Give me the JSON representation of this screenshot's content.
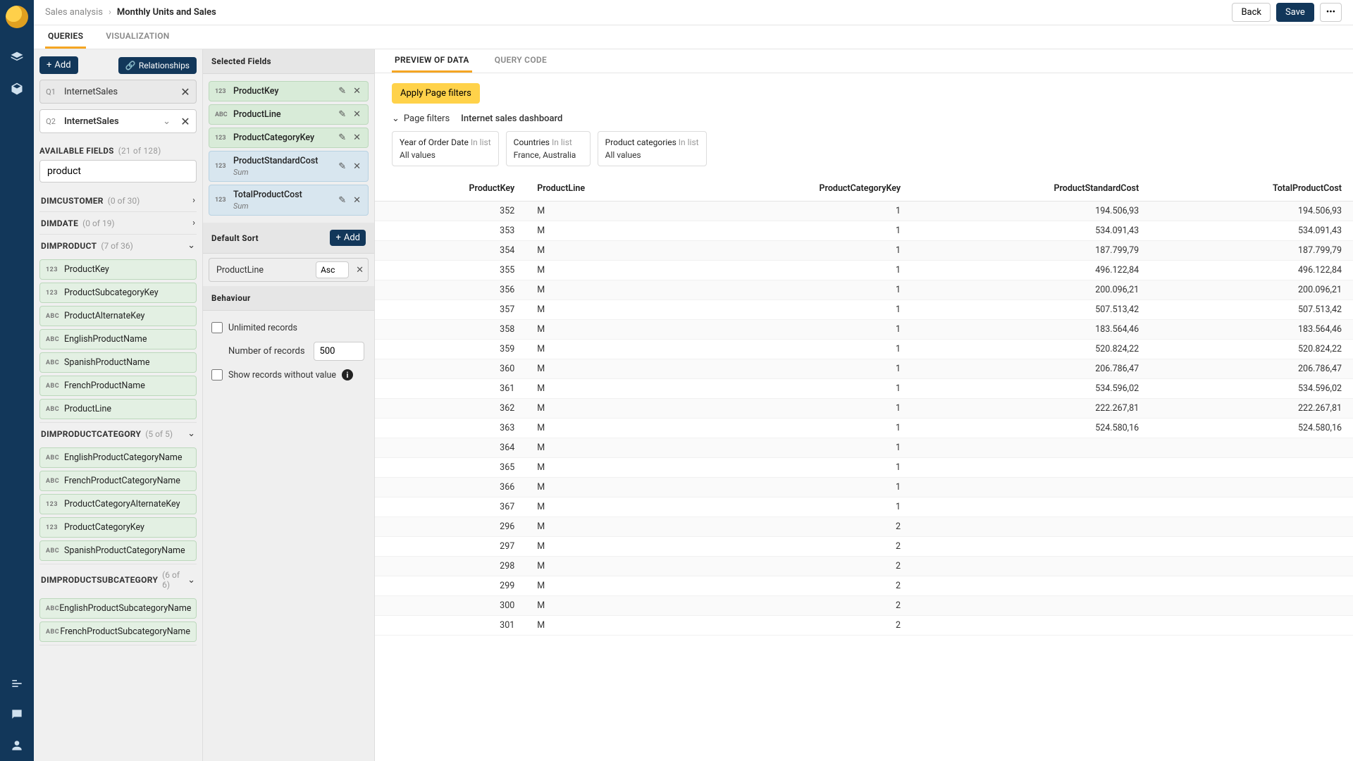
{
  "breadcrumb": {
    "parent": "Sales analysis",
    "current": "Monthly Units and Sales"
  },
  "buttons": {
    "back": "Back",
    "save": "Save",
    "more": "•••",
    "add": "Add",
    "relationships": "Relationships",
    "apply_filters": "Apply Page filters"
  },
  "top_tabs": {
    "queries": "Queries",
    "visualization": "Visualization"
  },
  "queries": [
    {
      "id": "Q1",
      "name": "InternetSales",
      "active": false
    },
    {
      "id": "Q2",
      "name": "InternetSales",
      "active": true
    }
  ],
  "available": {
    "label": "Available Fields",
    "count": "(21 of 128)",
    "search_value": "product",
    "groups": [
      {
        "name": "DIMCUSTOMER",
        "count": "(0 of 30)",
        "open": false,
        "fields": []
      },
      {
        "name": "DIMDATE",
        "count": "(0 of 19)",
        "open": false,
        "fields": []
      },
      {
        "name": "DIMPRODUCT",
        "count": "(7 of 36)",
        "open": true,
        "fields": [
          {
            "type": "123",
            "name": "ProductKey"
          },
          {
            "type": "123",
            "name": "ProductSubcategoryKey"
          },
          {
            "type": "ABC",
            "name": "ProductAlternateKey"
          },
          {
            "type": "ABC",
            "name": "EnglishProductName"
          },
          {
            "type": "ABC",
            "name": "SpanishProductName"
          },
          {
            "type": "ABC",
            "name": "FrenchProductName"
          },
          {
            "type": "ABC",
            "name": "ProductLine"
          }
        ]
      },
      {
        "name": "DIMPRODUCTCATEGORY",
        "count": "(5 of 5)",
        "open": true,
        "fields": [
          {
            "type": "ABC",
            "name": "EnglishProductCategoryName"
          },
          {
            "type": "ABC",
            "name": "FrenchProductCategoryName"
          },
          {
            "type": "123",
            "name": "ProductCategoryAlternateKey"
          },
          {
            "type": "123",
            "name": "ProductCategoryKey"
          },
          {
            "type": "ABC",
            "name": "SpanishProductCategoryName"
          }
        ]
      },
      {
        "name": "DIMPRODUCTSUBCATEGORY",
        "count": "(6 of 6)",
        "open": true,
        "fields": [
          {
            "type": "ABC",
            "name": "EnglishProductSubcategoryName"
          },
          {
            "type": "ABC",
            "name": "FrenchProductSubcategoryName"
          }
        ]
      }
    ]
  },
  "selected": {
    "label": "Selected Fields",
    "items": [
      {
        "type": "123",
        "name": "ProductKey",
        "agg": null,
        "tone": "green"
      },
      {
        "type": "ABC",
        "name": "ProductLine",
        "agg": null,
        "tone": "green"
      },
      {
        "type": "123",
        "name": "ProductCategoryKey",
        "agg": null,
        "tone": "green"
      },
      {
        "type": "123",
        "name": "ProductStandardCost",
        "agg": "Sum",
        "tone": "blue"
      },
      {
        "type": "123",
        "name": "TotalProductCost",
        "agg": "Sum",
        "tone": "blue"
      }
    ]
  },
  "sort": {
    "label": "Default Sort",
    "add": "Add",
    "field": "ProductLine",
    "dir": "Asc"
  },
  "behaviour": {
    "label": "Behaviour",
    "unlimited": "Unlimited records",
    "numrec_label": "Number of records",
    "numrec_value": "500",
    "show_no_value": "Show records without value"
  },
  "preview": {
    "tabs": {
      "data": "Preview of Data",
      "code": "Query Code"
    },
    "page_filters_label": "Page filters",
    "dashboard": "Internet sales dashboard",
    "filters": [
      {
        "title": "Year of Order Date",
        "sub": "In list",
        "value": "All values"
      },
      {
        "title": "Countries",
        "sub": "In list",
        "value": "France, Australia"
      },
      {
        "title": "Product categories",
        "sub": "In list",
        "value": "All values"
      }
    ],
    "columns": [
      "ProductKey",
      "ProductLine",
      "ProductCategoryKey",
      "ProductStandardCost",
      "TotalProductCost"
    ],
    "rows": [
      [
        "352",
        "M",
        "1",
        "194.506,93",
        "194.506,93"
      ],
      [
        "353",
        "M",
        "1",
        "534.091,43",
        "534.091,43"
      ],
      [
        "354",
        "M",
        "1",
        "187.799,79",
        "187.799,79"
      ],
      [
        "355",
        "M",
        "1",
        "496.122,84",
        "496.122,84"
      ],
      [
        "356",
        "M",
        "1",
        "200.096,21",
        "200.096,21"
      ],
      [
        "357",
        "M",
        "1",
        "507.513,42",
        "507.513,42"
      ],
      [
        "358",
        "M",
        "1",
        "183.564,46",
        "183.564,46"
      ],
      [
        "359",
        "M",
        "1",
        "520.824,22",
        "520.824,22"
      ],
      [
        "360",
        "M",
        "1",
        "206.786,47",
        "206.786,47"
      ],
      [
        "361",
        "M",
        "1",
        "534.596,02",
        "534.596,02"
      ],
      [
        "362",
        "M",
        "1",
        "222.267,81",
        "222.267,81"
      ],
      [
        "363",
        "M",
        "1",
        "524.580,16",
        "524.580,16"
      ],
      [
        "364",
        "M",
        "1",
        "",
        ""
      ],
      [
        "365",
        "M",
        "1",
        "",
        ""
      ],
      [
        "366",
        "M",
        "1",
        "",
        ""
      ],
      [
        "367",
        "M",
        "1",
        "",
        ""
      ],
      [
        "296",
        "M",
        "2",
        "",
        ""
      ],
      [
        "297",
        "M",
        "2",
        "",
        ""
      ],
      [
        "298",
        "M",
        "2",
        "",
        ""
      ],
      [
        "299",
        "M",
        "2",
        "",
        ""
      ],
      [
        "300",
        "M",
        "2",
        "",
        ""
      ],
      [
        "301",
        "M",
        "2",
        "",
        ""
      ]
    ]
  }
}
